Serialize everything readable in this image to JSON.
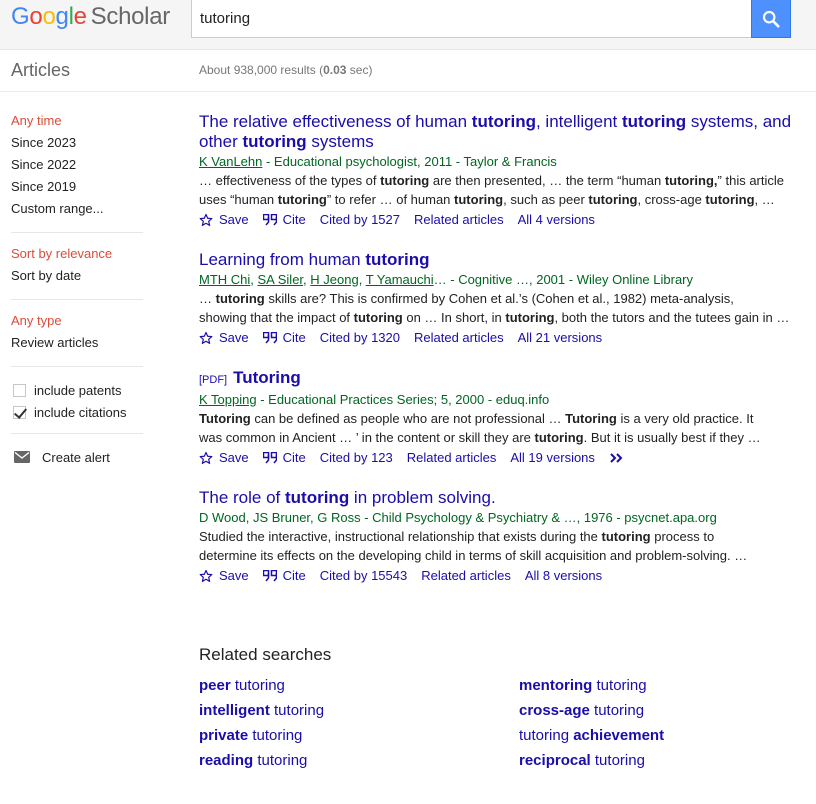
{
  "header": {
    "logo_letters": [
      "G",
      "o",
      "o",
      "g",
      "l",
      "e"
    ],
    "logo_product": "Scholar",
    "search_value": "tutoring",
    "search_icon": "search-icon"
  },
  "subheader": {
    "section": "Articles",
    "count_prefix": "About 938,000 results (",
    "count_time": "0.03",
    "count_suffix": " sec)"
  },
  "sidebar": {
    "time_filters": [
      {
        "label": "Any time",
        "selected": true
      },
      {
        "label": "Since 2023",
        "selected": false
      },
      {
        "label": "Since 2022",
        "selected": false
      },
      {
        "label": "Since 2019",
        "selected": false
      },
      {
        "label": "Custom range...",
        "selected": false
      }
    ],
    "sort_options": [
      {
        "label": "Sort by relevance",
        "selected": true
      },
      {
        "label": "Sort by date",
        "selected": false
      }
    ],
    "type_options": [
      {
        "label": "Any type",
        "selected": true
      },
      {
        "label": "Review articles",
        "selected": false
      }
    ],
    "checkboxes": [
      {
        "label": "include patents",
        "checked": false
      },
      {
        "label": "include citations",
        "checked": true
      }
    ],
    "alert_label": "Create alert",
    "alert_icon": "envelope-icon"
  },
  "results": [
    {
      "pdf": "",
      "title_parts": [
        {
          "t": "The relative effectiveness of human ",
          "b": false
        },
        {
          "t": "tutoring",
          "b": true
        },
        {
          "t": ", intelligent ",
          "b": false
        },
        {
          "t": "tutoring",
          "b": true
        },
        {
          "t": " systems, and other ",
          "b": false
        },
        {
          "t": "tutoring",
          "b": true
        },
        {
          "t": " systems",
          "b": false
        }
      ],
      "meta_parts": [
        {
          "t": "K VanLehn",
          "u": true
        },
        {
          "t": " - Educational psychologist, 2011 - Taylor & Francis",
          "u": false
        }
      ],
      "snippet_lines": [
        [
          {
            "t": "… effectiveness of the types of ",
            "b": false
          },
          {
            "t": "tutoring",
            "b": true
          },
          {
            "t": " are then presented, … the term “human ",
            "b": false
          },
          {
            "t": "tutoring,",
            "b": true
          },
          {
            "t": "” this article",
            "b": false
          }
        ],
        [
          {
            "t": "uses “human ",
            "b": false
          },
          {
            "t": "tutoring",
            "b": true
          },
          {
            "t": "” to refer … of human ",
            "b": false
          },
          {
            "t": "tutoring",
            "b": true
          },
          {
            "t": ", such as peer ",
            "b": false
          },
          {
            "t": "tutoring",
            "b": true
          },
          {
            "t": ", cross-age ",
            "b": false
          },
          {
            "t": "tutoring",
            "b": true
          },
          {
            "t": ", …",
            "b": false
          }
        ]
      ],
      "save": "Save",
      "cite": "Cite",
      "cited_by": "Cited by 1527",
      "related": "Related articles",
      "versions": "All 4 versions",
      "more": false
    },
    {
      "pdf": "",
      "title_parts": [
        {
          "t": "Learning from human ",
          "b": false
        },
        {
          "t": "tutoring",
          "b": true
        }
      ],
      "meta_parts": [
        {
          "t": "MTH Chi",
          "u": true
        },
        {
          "t": ", ",
          "u": false
        },
        {
          "t": "SA Siler",
          "u": true
        },
        {
          "t": ", ",
          "u": false
        },
        {
          "t": "H Jeong",
          "u": true
        },
        {
          "t": ", ",
          "u": false
        },
        {
          "t": "T Yamauchi",
          "u": true
        },
        {
          "t": "… - Cognitive …, 2001 - Wiley Online Library",
          "u": false
        }
      ],
      "snippet_lines": [
        [
          {
            "t": "… ",
            "b": false
          },
          {
            "t": "tutoring",
            "b": true
          },
          {
            "t": " skills are? This is confirmed by Cohen et al.’s (Cohen et al., 1982) meta-analysis,",
            "b": false
          }
        ],
        [
          {
            "t": "showing that the impact of ",
            "b": false
          },
          {
            "t": "tutoring",
            "b": true
          },
          {
            "t": " on … In short, in ",
            "b": false
          },
          {
            "t": "tutoring",
            "b": true
          },
          {
            "t": ", both the tutors and the tutees gain in …",
            "b": false
          }
        ]
      ],
      "save": "Save",
      "cite": "Cite",
      "cited_by": "Cited by 1320",
      "related": "Related articles",
      "versions": "All 21 versions",
      "more": false
    },
    {
      "pdf": "[PDF]",
      "title_parts": [
        {
          "t": "Tutoring",
          "b": true
        }
      ],
      "meta_parts": [
        {
          "t": "K Topping",
          "u": true
        },
        {
          "t": " - Educational Practices Series; 5, 2000 - eduq.info",
          "u": false
        }
      ],
      "snippet_lines": [
        [
          {
            "t": "Tutoring",
            "b": true
          },
          {
            "t": " can be defined as people who are not professional … ",
            "b": false
          },
          {
            "t": "Tutoring",
            "b": true
          },
          {
            "t": " is a very old practice. It",
            "b": false
          }
        ],
        [
          {
            "t": "was common in Ancient … ’ in the content or skill they are ",
            "b": false
          },
          {
            "t": "tutoring",
            "b": true
          },
          {
            "t": ". But it is usually best if they …",
            "b": false
          }
        ]
      ],
      "save": "Save",
      "cite": "Cite",
      "cited_by": "Cited by 123",
      "related": "Related articles",
      "versions": "All 19 versions",
      "more": true
    },
    {
      "pdf": "",
      "title_parts": [
        {
          "t": "The role of ",
          "b": false
        },
        {
          "t": "tutoring",
          "b": true
        },
        {
          "t": " in problem solving.",
          "b": false
        }
      ],
      "meta_parts": [
        {
          "t": "D Wood, JS Bruner, G Ross - Child Psychology & Psychiatry & …, 1976 - psycnet.apa.org",
          "u": false
        }
      ],
      "snippet_lines": [
        [
          {
            "t": "Studied the interactive, instructional relationship that exists during the ",
            "b": false
          },
          {
            "t": "tutoring",
            "b": true
          },
          {
            "t": " process to",
            "b": false
          }
        ],
        [
          {
            "t": "determine its effects on the developing child in terms of skill acquisition and problem-solving. …",
            "b": false
          }
        ]
      ],
      "save": "Save",
      "cite": "Cite",
      "cited_by": "Cited by 15543",
      "related": "Related articles",
      "versions": "All 8 versions",
      "more": false
    }
  ],
  "related_searches": {
    "heading": "Related searches",
    "items": [
      [
        {
          "t": "peer",
          "b": true
        },
        {
          "t": " tutoring",
          "b": false
        }
      ],
      [
        {
          "t": "mentoring",
          "b": true
        },
        {
          "t": " tutoring",
          "b": false
        }
      ],
      [
        {
          "t": "intelligent",
          "b": true
        },
        {
          "t": " tutoring",
          "b": false
        }
      ],
      [
        {
          "t": "cross-age",
          "b": true
        },
        {
          "t": " tutoring",
          "b": false
        }
      ],
      [
        {
          "t": "private",
          "b": true
        },
        {
          "t": " tutoring",
          "b": false
        }
      ],
      [
        {
          "t": "tutoring ",
          "b": false
        },
        {
          "t": "achievement",
          "b": true
        }
      ],
      [
        {
          "t": "reading",
          "b": true
        },
        {
          "t": " tutoring",
          "b": false
        }
      ],
      [
        {
          "t": "reciprocal",
          "b": true
        },
        {
          "t": " tutoring",
          "b": false
        }
      ]
    ]
  },
  "colors": {
    "link": "#1a0dab",
    "meta_green": "#006621",
    "selected_red": "#dd4b39",
    "search_button": "#4d90fe"
  }
}
